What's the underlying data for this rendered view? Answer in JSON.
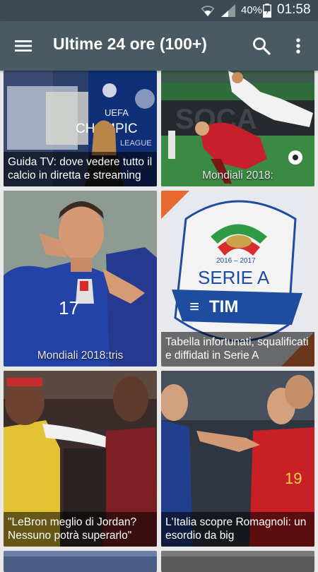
{
  "status_bar": {
    "battery_percent": "40%",
    "time": "01:58"
  },
  "app_bar": {
    "title": "Ultime 24 ore (100+)",
    "icons": [
      "menu-icon",
      "search-icon",
      "more-vert-icon"
    ]
  },
  "articles": [
    {
      "caption": "Guida TV: dove vedere tutto il calcio in diretta e streaming",
      "image_text": [
        "UEFA",
        "CHAMPIC",
        "LEAGUE"
      ]
    },
    {
      "caption": "Mondiali 2018:"
    },
    {
      "caption": "Mondiali 2018:tris",
      "image_text": [
        "17"
      ]
    },
    {
      "caption": "Tabella infortunati, squalificati e diffidati in Serie A",
      "image_text": [
        "2016 – 2017",
        "SERIE A",
        "TIM"
      ]
    },
    {
      "caption": "\"LeBron meglio di Jordan? Nessuno potrà superarlo\""
    },
    {
      "caption": "L'Italia scopre Romagnoli: un esordio da big",
      "image_text": [
        "19"
      ]
    }
  ],
  "colors": {
    "status_bar": "#3b4a54",
    "app_bar": "#4a5a63",
    "background": "#e9e9e9"
  }
}
